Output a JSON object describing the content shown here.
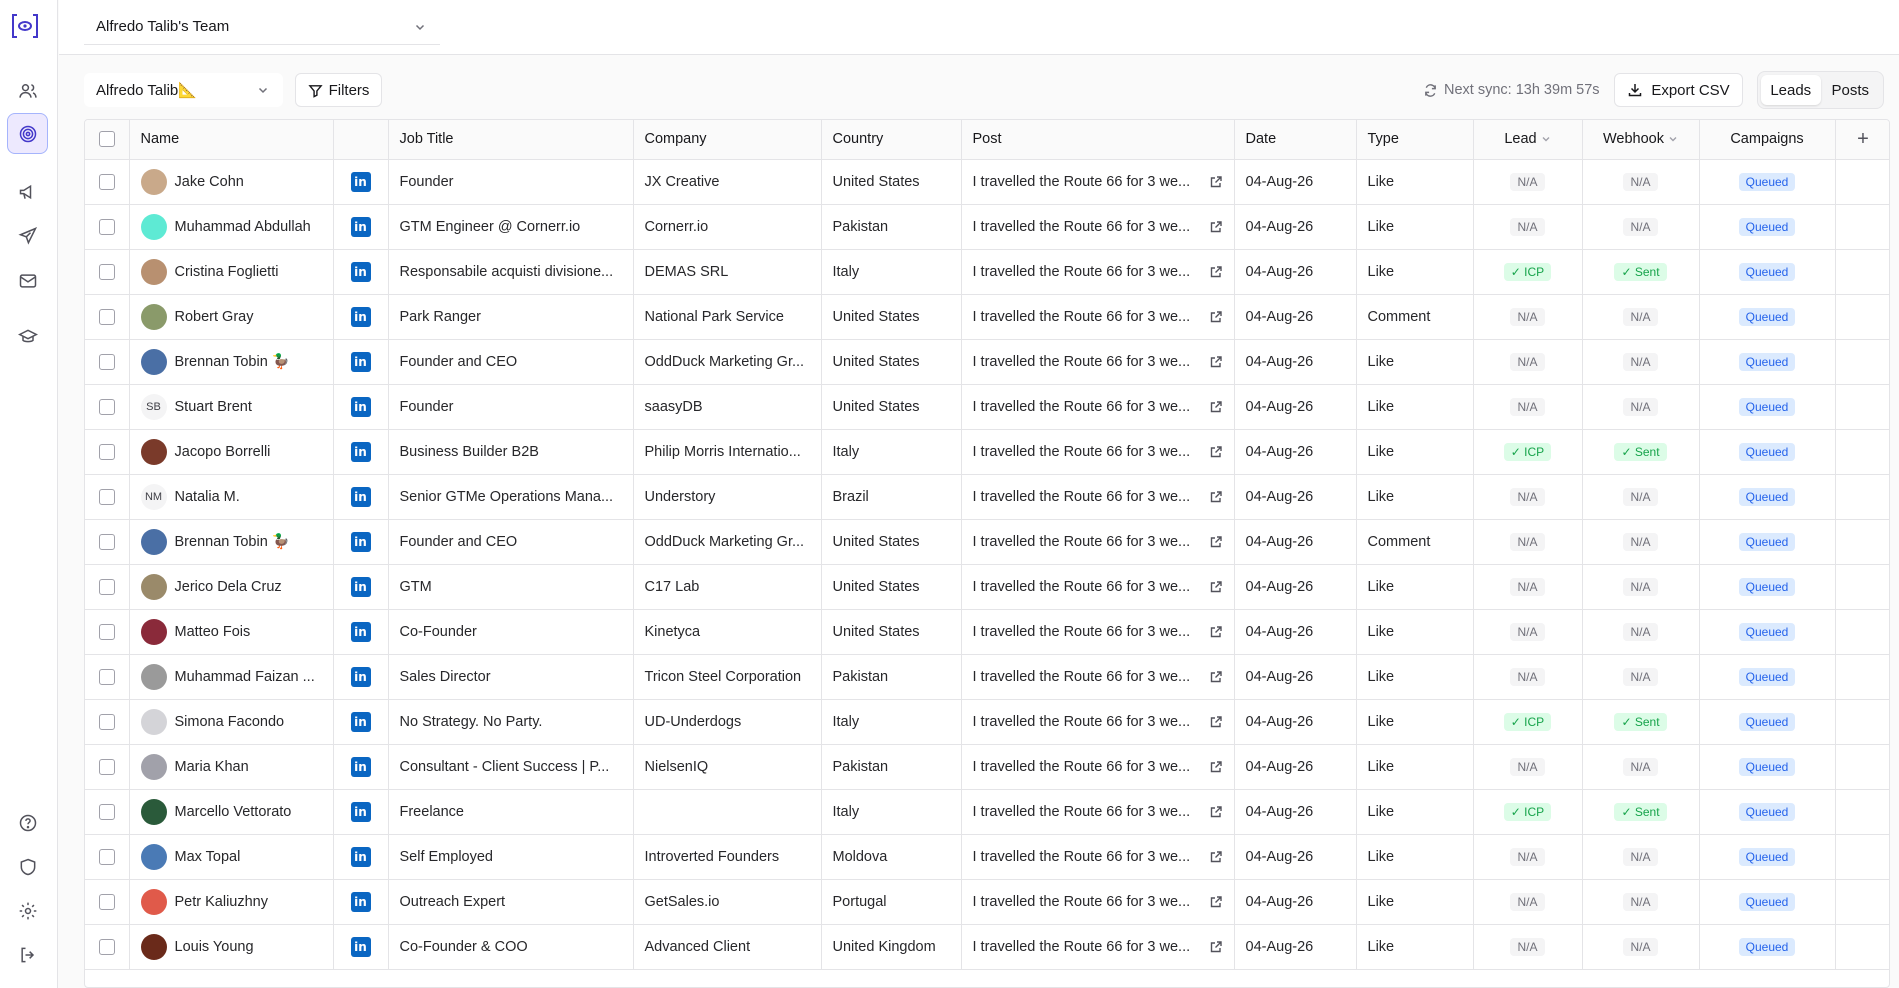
{
  "team": "Alfredo Talib's Team",
  "toolbar": {
    "user": "Alfredo Talib📐",
    "filters": "Filters",
    "sync": "Next sync: 13h 39m 57s",
    "export": "Export CSV",
    "seg_leads": "Leads",
    "seg_posts": "Posts"
  },
  "columns": {
    "name": "Name",
    "job": "Job Title",
    "company": "Company",
    "country": "Country",
    "post": "Post",
    "date": "Date",
    "type": "Type",
    "lead": "Lead",
    "webhook": "Webhook",
    "campaigns": "Campaigns",
    "add": "+"
  },
  "colors": {
    "accent": "#4338ca",
    "linkedin": "#0a66c2",
    "queued": "#2563eb",
    "ok": "#16a34a"
  },
  "rows": [
    {
      "name": "Jake Cohn",
      "avatar": "#c9a98a",
      "job": "Founder",
      "company": "JX Creative",
      "country": "United States",
      "post": "I travelled the Route 66 for 3 we...",
      "date": "04-Aug-26",
      "type": "Like",
      "lead": "N/A",
      "webhook": "N/A",
      "campaign": "Queued"
    },
    {
      "name": "Muhammad Abdullah",
      "avatar": "#5eead4",
      "job": "GTM Engineer @ Cornerr.io",
      "company": "Cornerr.io",
      "country": "Pakistan",
      "post": "I travelled the Route 66 for 3 we...",
      "date": "04-Aug-26",
      "type": "Like",
      "lead": "N/A",
      "webhook": "N/A",
      "campaign": "Queued"
    },
    {
      "name": "Cristina Foglietti",
      "avatar": "#b89070",
      "job": "Responsabile acquisti divisione...",
      "company": "DEMAS SRL",
      "country": "Italy",
      "post": "I travelled the Route 66 for 3 we...",
      "date": "04-Aug-26",
      "type": "Like",
      "lead": "✓ ICP",
      "webhook": "✓ Sent",
      "campaign": "Queued"
    },
    {
      "name": "Robert Gray",
      "avatar": "#8a9a6a",
      "job": "Park Ranger",
      "company": "National Park Service",
      "country": "United States",
      "post": "I travelled the Route 66 for 3 we...",
      "date": "04-Aug-26",
      "type": "Comment",
      "lead": "N/A",
      "webhook": "N/A",
      "campaign": "Queued"
    },
    {
      "name": "Brennan Tobin 🦆",
      "avatar": "#4a6fa5",
      "job": "Founder and CEO",
      "company": "OddDuck Marketing Gr...",
      "country": "United States",
      "post": "I travelled the Route 66 for 3 we...",
      "date": "04-Aug-26",
      "type": "Like",
      "lead": "N/A",
      "webhook": "N/A",
      "campaign": "Queued"
    },
    {
      "name": "Stuart Brent",
      "initials": "SB",
      "job": "Founder",
      "company": "saasyDB",
      "country": "United States",
      "post": "I travelled the Route 66 for 3 we...",
      "date": "04-Aug-26",
      "type": "Like",
      "lead": "N/A",
      "webhook": "N/A",
      "campaign": "Queued"
    },
    {
      "name": "Jacopo Borrelli",
      "avatar": "#7a3a2a",
      "job": "Business Builder B2B",
      "company": "Philip Morris Internatio...",
      "country": "Italy",
      "post": "I travelled the Route 66 for 3 we...",
      "date": "04-Aug-26",
      "type": "Like",
      "lead": "✓ ICP",
      "webhook": "✓ Sent",
      "campaign": "Queued"
    },
    {
      "name": "Natalia M.",
      "initials": "NM",
      "job": "Senior GTMe Operations Mana...",
      "company": "Understory",
      "country": "Brazil",
      "post": "I travelled the Route 66 for 3 we...",
      "date": "04-Aug-26",
      "type": "Like",
      "lead": "N/A",
      "webhook": "N/A",
      "campaign": "Queued"
    },
    {
      "name": "Brennan Tobin 🦆",
      "avatar": "#4a6fa5",
      "job": "Founder and CEO",
      "company": "OddDuck Marketing Gr...",
      "country": "United States",
      "post": "I travelled the Route 66 for 3 we...",
      "date": "04-Aug-26",
      "type": "Comment",
      "lead": "N/A",
      "webhook": "N/A",
      "campaign": "Queued"
    },
    {
      "name": "Jerico Dela Cruz",
      "avatar": "#9a8a6a",
      "job": "GTM",
      "company": "C17 Lab",
      "country": "United States",
      "post": "I travelled the Route 66 for 3 we...",
      "date": "04-Aug-26",
      "type": "Like",
      "lead": "N/A",
      "webhook": "N/A",
      "campaign": "Queued"
    },
    {
      "name": "Matteo Fois",
      "avatar": "#8a2a3a",
      "job": "Co-Founder",
      "company": "Kinetyca",
      "country": "United States",
      "post": "I travelled the Route 66 for 3 we...",
      "date": "04-Aug-26",
      "type": "Like",
      "lead": "N/A",
      "webhook": "N/A",
      "campaign": "Queued"
    },
    {
      "name": "Muhammad Faizan ...",
      "avatar": "#9a9a9a",
      "job": "Sales Director",
      "company": "Tricon Steel Corporation",
      "country": "Pakistan",
      "post": "I travelled the Route 66 for 3 we...",
      "date": "04-Aug-26",
      "type": "Like",
      "lead": "N/A",
      "webhook": "N/A",
      "campaign": "Queued"
    },
    {
      "name": "Simona Facondo",
      "avatar": "#d4d4d8",
      "job": "No Strategy. No Party.",
      "company": "UD-Underdogs",
      "country": "Italy",
      "post": "I travelled the Route 66 for 3 we...",
      "date": "04-Aug-26",
      "type": "Like",
      "lead": "✓ ICP",
      "webhook": "✓ Sent",
      "campaign": "Queued"
    },
    {
      "name": "Maria Khan",
      "avatar": "#a1a1aa",
      "job": "Consultant - Client Success | P...",
      "company": "NielsenIQ",
      "country": "Pakistan",
      "post": "I travelled the Route 66 for 3 we...",
      "date": "04-Aug-26",
      "type": "Like",
      "lead": "N/A",
      "webhook": "N/A",
      "campaign": "Queued"
    },
    {
      "name": "Marcello Vettorato",
      "avatar": "#2a5a3a",
      "job": "Freelance",
      "company": "",
      "country": "Italy",
      "post": "I travelled the Route 66 for 3 we...",
      "date": "04-Aug-26",
      "type": "Like",
      "lead": "✓ ICP",
      "webhook": "✓ Sent",
      "campaign": "Queued"
    },
    {
      "name": "Max Topal",
      "avatar": "#4a7ab5",
      "job": "Self Employed",
      "company": "Introverted Founders",
      "country": "Moldova",
      "post": "I travelled the Route 66 for 3 we...",
      "date": "04-Aug-26",
      "type": "Like",
      "lead": "N/A",
      "webhook": "N/A",
      "campaign": "Queued"
    },
    {
      "name": "Petr Kaliuzhny",
      "avatar": "#e05a4a",
      "job": "Outreach Expert",
      "company": "GetSales.io",
      "country": "Portugal",
      "post": "I travelled the Route 66 for 3 we...",
      "date": "04-Aug-26",
      "type": "Like",
      "lead": "N/A",
      "webhook": "N/A",
      "campaign": "Queued"
    },
    {
      "name": "Louis Young",
      "avatar": "#6a2a1a",
      "job": "Co-Founder & COO",
      "company": "Advanced Client",
      "country": "United Kingdom",
      "post": "I travelled the Route 66 for 3 we...",
      "date": "04-Aug-26",
      "type": "Like",
      "lead": "N/A",
      "webhook": "N/A",
      "campaign": "Queued"
    }
  ]
}
